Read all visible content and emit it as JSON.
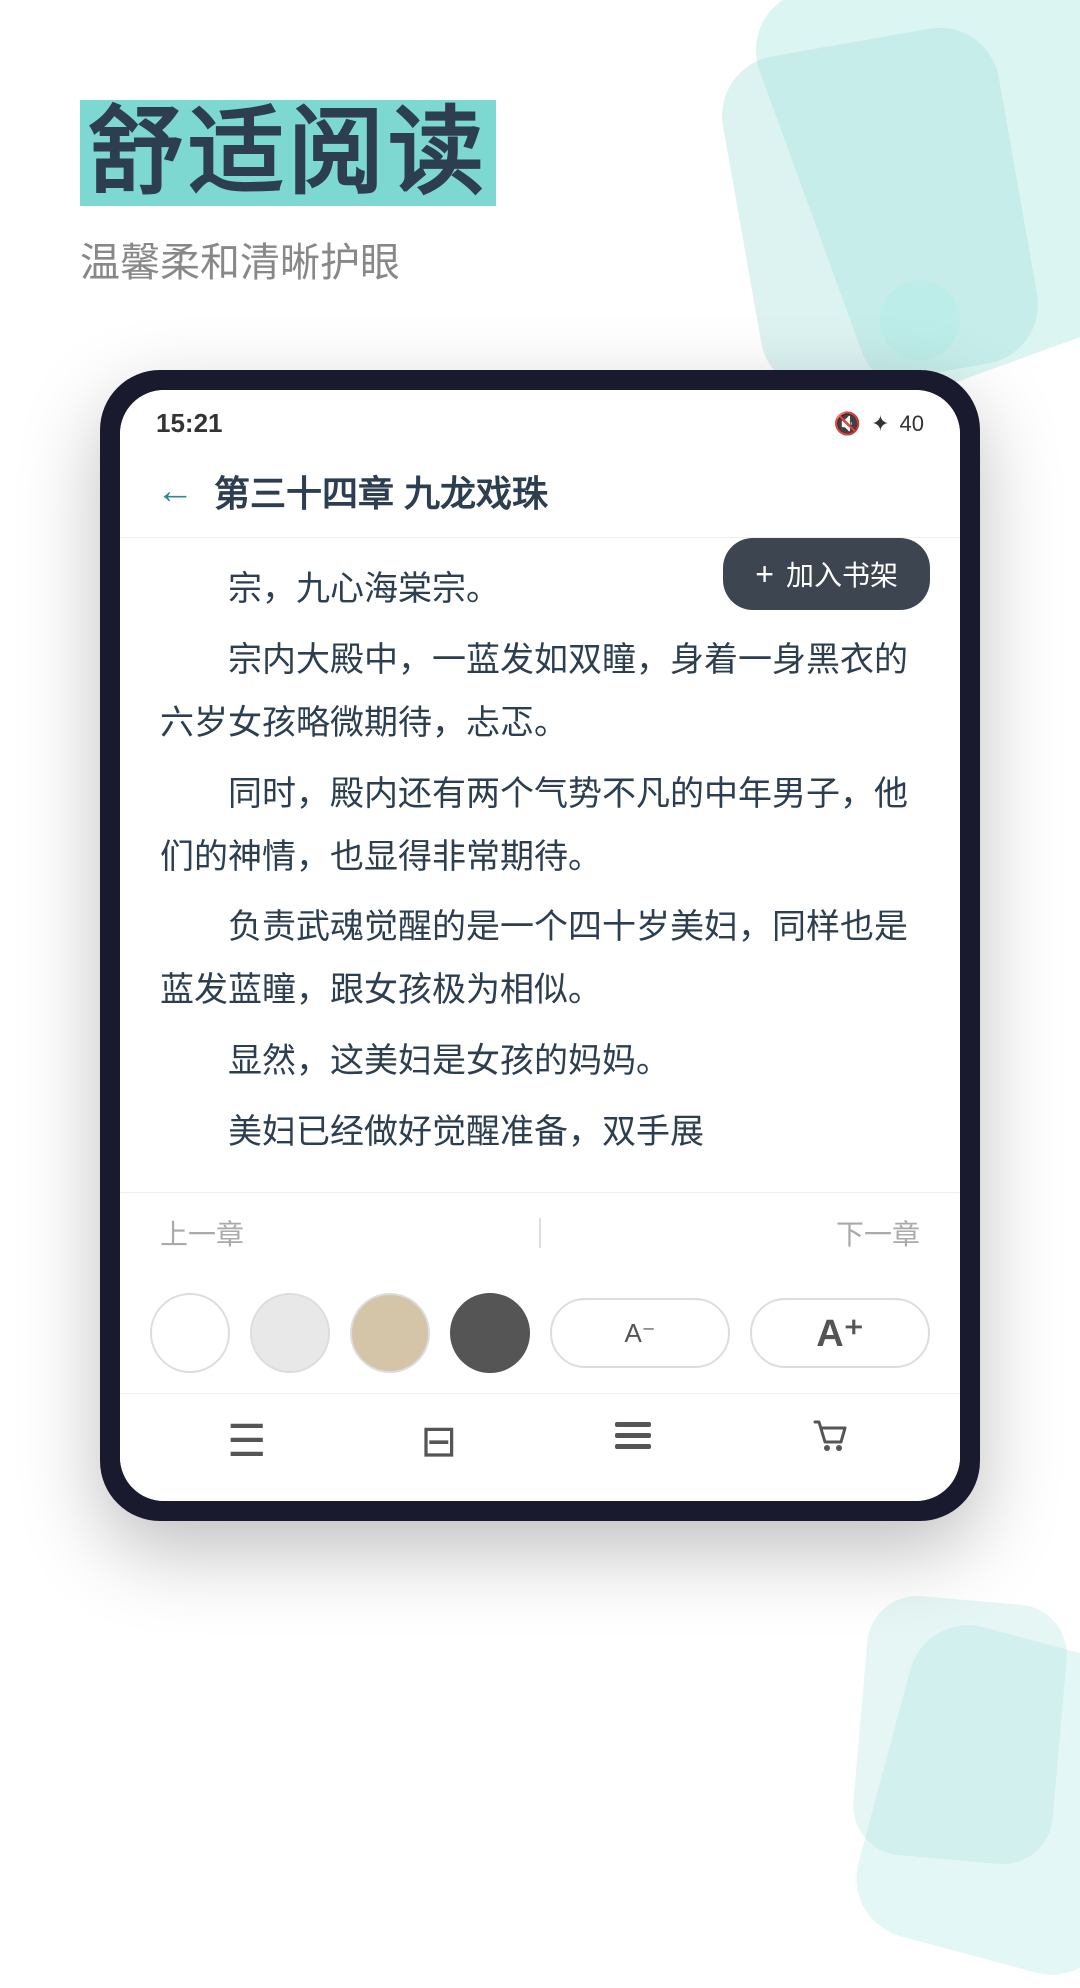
{
  "background": {
    "color": "#ffffff",
    "accent_color": "#7dd8d2"
  },
  "hero": {
    "title": "舒适阅读",
    "title_part1": "舒适",
    "title_part2": "阅读",
    "subtitle": "温馨柔和清晰护眼"
  },
  "phone": {
    "status_bar": {
      "time": "15:21",
      "icons": "◂ ✦ 40"
    },
    "chapter_header": {
      "back_icon": "←",
      "title": "第三十四章 九龙戏珠"
    },
    "tooltip": {
      "plus_icon": "+",
      "label": "加入书架"
    },
    "content": [
      "宗，九心海棠宗。",
      "宗内大殿中，一蓝发如双瞳，身着一身黑衣的六岁女孩略微期待，忐忑。",
      "同时，殿内还有两个气势不凡的中年男子，他们的神情，也显得非常期待。",
      "负责武魂觉醒的是一个四十岁美妇，同样也是蓝发蓝瞳，跟女孩极为相似。",
      "显然，这美妇是女孩的妈妈。",
      "美妇已经做好觉醒准备，双手展"
    ],
    "navigation": {
      "prev": "上一章",
      "next": "下一章"
    },
    "theme_controls": {
      "circles": [
        "white",
        "light-gray",
        "beige",
        "dark"
      ],
      "font_decrease": "A⁻",
      "font_increase": "A⁺"
    },
    "bottom_nav": {
      "items": [
        {
          "icon": "☰",
          "label": ""
        },
        {
          "icon": "⊟",
          "label": ""
        },
        {
          "icon": "☰",
          "label": ""
        },
        {
          "icon": "🛒",
          "label": ""
        }
      ]
    }
  }
}
